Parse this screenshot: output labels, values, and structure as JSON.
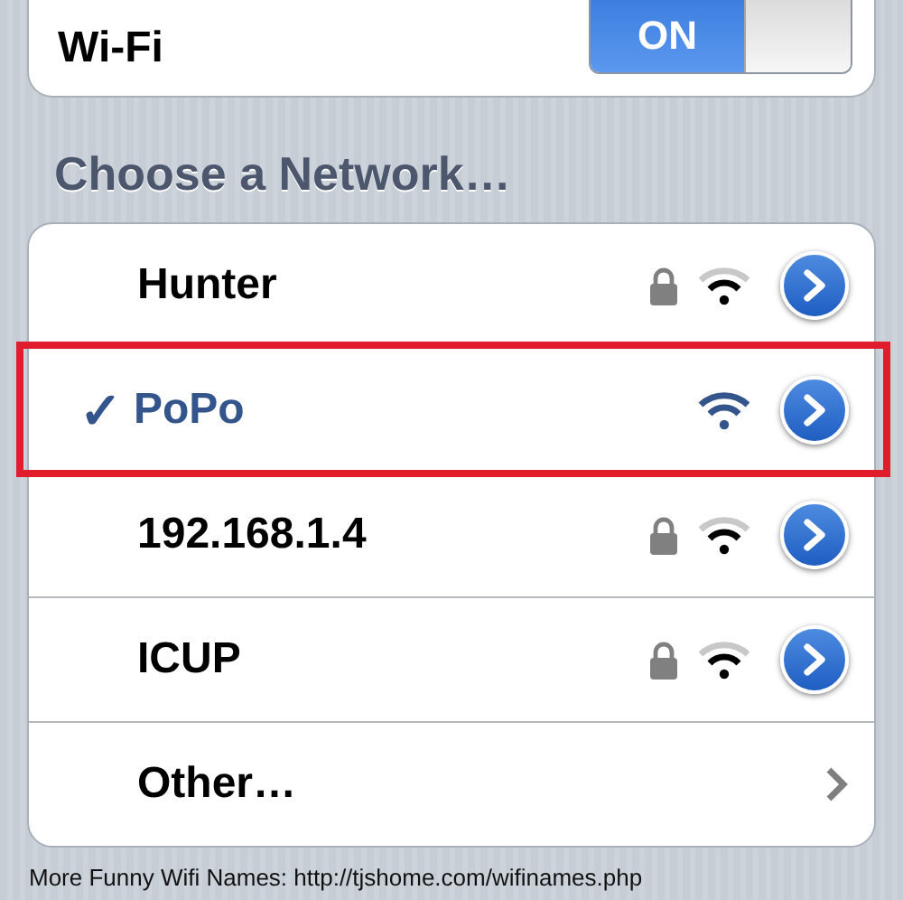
{
  "wifi": {
    "label": "Wi-Fi",
    "toggle": {
      "label": "ON",
      "on": true
    }
  },
  "section_header": "Choose a Network…",
  "networks": [
    {
      "kind": "network",
      "name": "Hunter",
      "selected": false,
      "secured": true,
      "highlighted": false
    },
    {
      "kind": "network",
      "name": "PoPo",
      "selected": true,
      "secured": false,
      "highlighted": true
    },
    {
      "kind": "network",
      "name": "192.168.1.4",
      "selected": false,
      "secured": true,
      "highlighted": false
    },
    {
      "kind": "network",
      "name": "ICUP",
      "selected": false,
      "secured": true,
      "highlighted": false
    },
    {
      "kind": "other",
      "name": "Other…",
      "selected": false,
      "secured": false,
      "highlighted": false
    }
  ],
  "checkmark": "✓",
  "caption": "More Funny Wifi Names: http://tjshome.com/wifinames.php"
}
